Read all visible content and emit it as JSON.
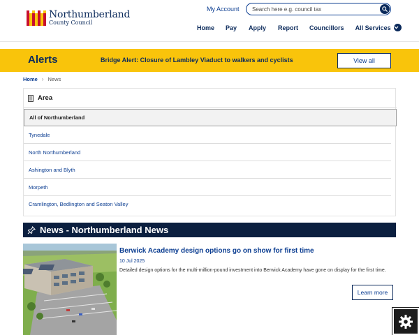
{
  "logo": {
    "title": "Northumberland",
    "subtitle": "County Council"
  },
  "header": {
    "my_account": "My Account",
    "search_placeholder": "Search here e.g. council tax",
    "nav": {
      "home": "Home",
      "pay": "Pay",
      "apply": "Apply",
      "report": "Report",
      "councillors": "Councillors",
      "all_services": "All Services"
    }
  },
  "alerts": {
    "title": "Alerts",
    "message": "Bridge Alert: Closure of Lambley Viaduct to walkers and cyclists",
    "view_all": "View all"
  },
  "breadcrumb": {
    "home": "Home",
    "current": "News"
  },
  "area": {
    "title": "Area",
    "items": [
      {
        "label": "All of Northumberland",
        "selected": true
      },
      {
        "label": "Tynedale"
      },
      {
        "label": "North Northumberland"
      },
      {
        "label": "Ashington and Blyth"
      },
      {
        "label": "Morpeth"
      },
      {
        "label": "Cramlington, Bedlington and Seaton Valley"
      }
    ]
  },
  "news": {
    "title": "News - Northumberland News",
    "items": [
      {
        "headline": "Berwick Academy design options go on show for first time",
        "date": "10 Jul 2025",
        "description": "Detailed design options for the multi-million-pound investment into Berwick Academy have gone on display for the first time.",
        "button": "Learn more"
      }
    ]
  },
  "colors": {
    "brand_navy": "#0b2a5b",
    "link_blue": "#0b3d91",
    "alert_yellow": "#f9c40b",
    "news_bar": "#0b1f3f"
  },
  "icons": {
    "search": "search-icon",
    "chevron": "chevron-down-icon",
    "area": "document-icon",
    "news": "pin-icon",
    "settings": "gear-icon"
  }
}
